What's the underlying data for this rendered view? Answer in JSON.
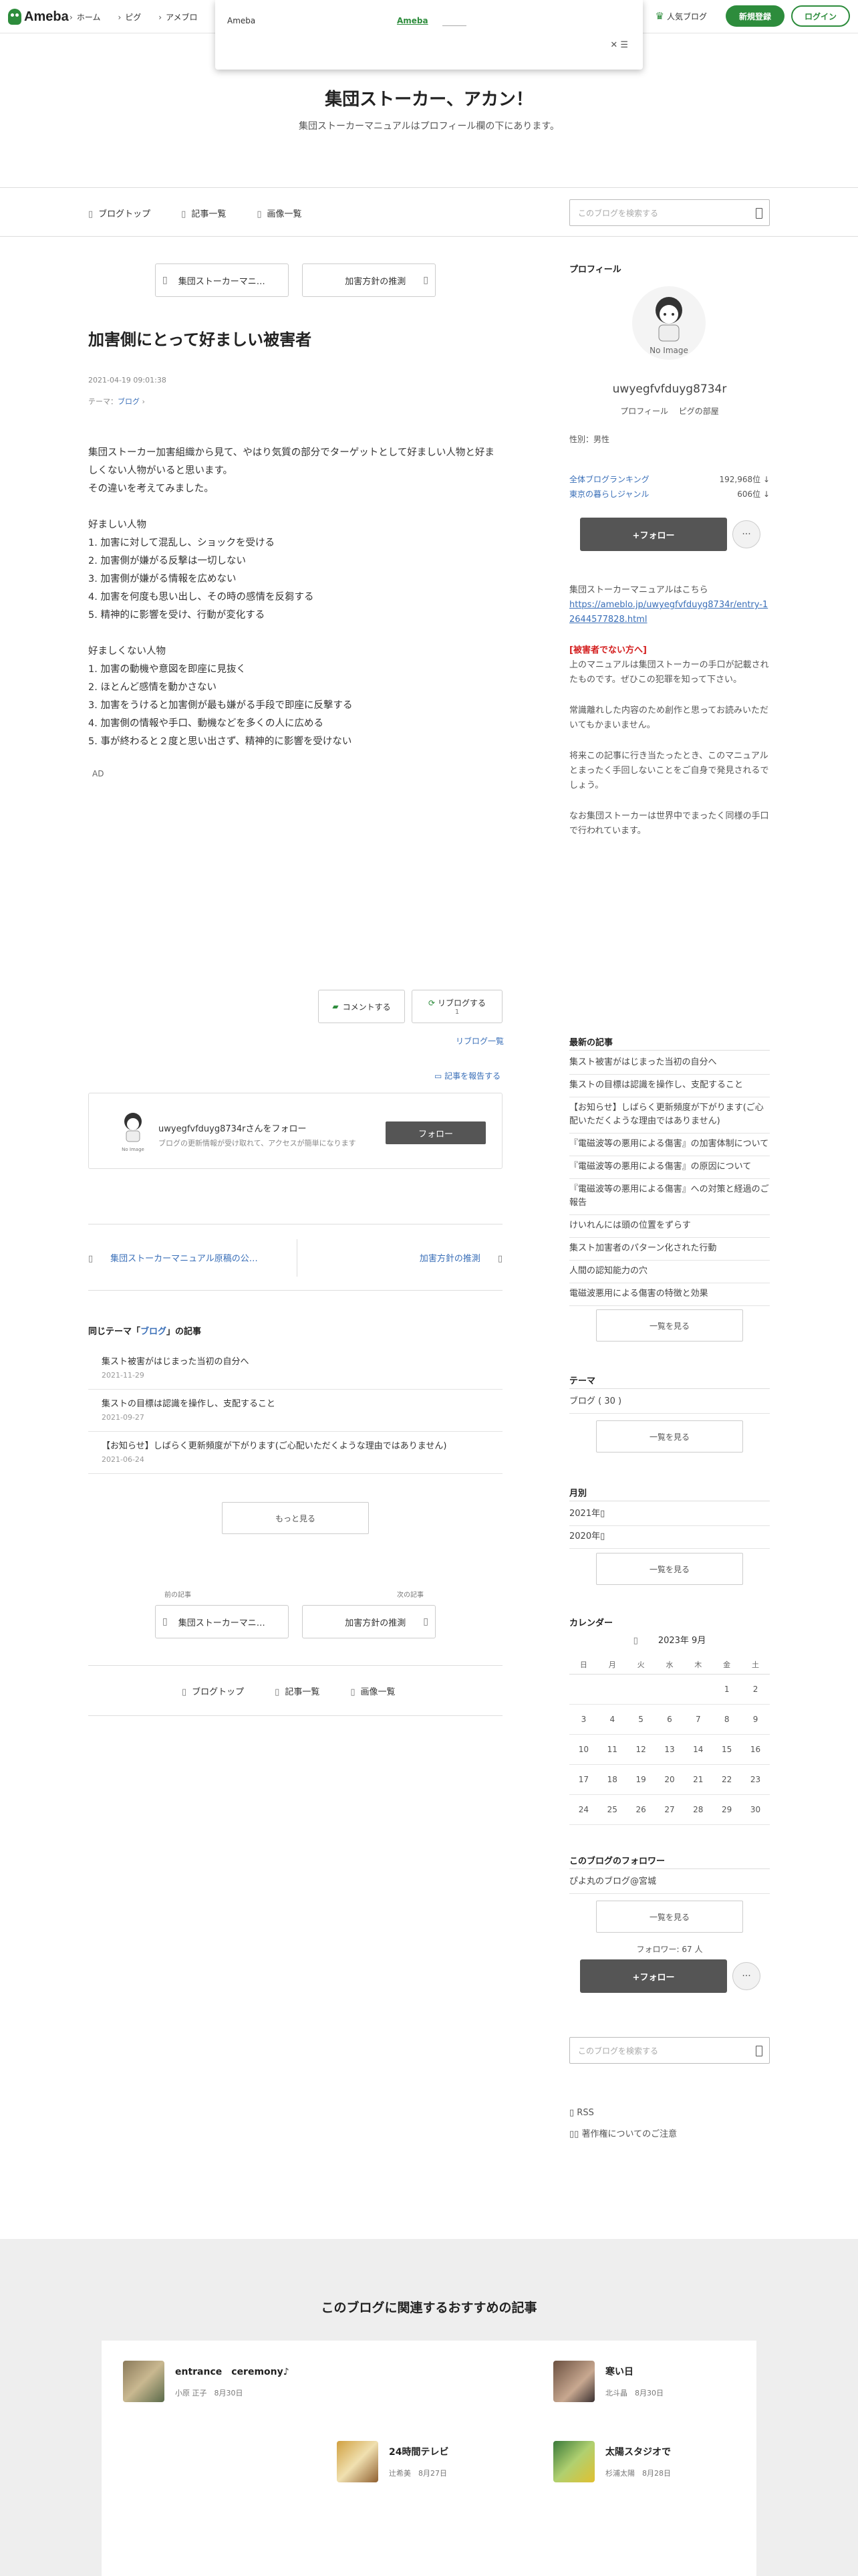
{
  "header": {
    "logo_text": "Ameba",
    "nav": [
      "ホーム",
      "ピグ",
      "アメブロ"
    ],
    "popular": "人気ブログ",
    "signup": "新規登録",
    "login": "ログイン"
  },
  "popup": {
    "title": "Ameba",
    "link": "Ameba",
    "close": "✕ ☰"
  },
  "blog": {
    "title": "集団ストーカー、アカン！",
    "description": "集団ストーカーマニュアルはプロフィール欄の下にあります。"
  },
  "blognav": {
    "items": [
      "ブログトップ",
      "記事一覧",
      "画像一覧"
    ],
    "search_placeholder": "このブログを検索する"
  },
  "article": {
    "prev_label": "集団ストーカーマニ…",
    "next_label": "加害方針の推測",
    "title": "加害側にとって好ましい被害者",
    "date": "2021-04-19 09:01:38",
    "theme_prefix": "テーマ：",
    "theme": "ブログ",
    "body": "集団ストーカー加害組織から見て、やはり気質の部分でターゲットとして好ましい人物と好ましくない人物がいると思います。\nその違いを考えてみました。\n\n好ましい人物\n1. 加害に対して混乱し、ショックを受ける\n2. 加害側が嫌がる反撃は一切しない\n3. 加害側が嫌がる情報を広めない\n4. 加害を何度も思い出し、その時の感情を反芻する\n5. 精神的に影響を受け、行動が変化する\n\n好ましくない人物\n1. 加害の動機や意図を即座に見抜く\n2. ほとんど感情を動かさない\n3. 加害をうけると加害側が最も嫌がる手段で即座に反撃する\n4. 加害側の情報や手口、動機などを多くの人に広める\n5. 事が終わると２度と思い出さず、精神的に影響を受けない",
    "ad_label": "AD",
    "comment_btn": "コメントする",
    "reblog_btn": "リブログする",
    "reblog_count": "1",
    "reblog_list": "リブログ一覧",
    "report": "記事を報告する"
  },
  "follow_card": {
    "title": "uwyegfvfduyg8734rさんをフォロー",
    "sub": "ブログの更新情報が受け取れて、アクセスが簡単になります",
    "button": "フォロー",
    "no_image": "No Image"
  },
  "prevnext": {
    "prev": "集団ストーカーマニュアル原稿の公…",
    "next": "加害方針の推測"
  },
  "same_theme": {
    "heading_pre": "同じテーマ「",
    "heading_theme": "ブログ",
    "heading_post": "」の記事",
    "items": [
      {
        "title": "集スト被害がはじまった当初の自分へ",
        "date": "2021-11-29"
      },
      {
        "title": "集ストの目標は認識を操作し、支配すること",
        "date": "2021-09-27"
      },
      {
        "title": "【お知らせ】しばらく更新頻度が下がります(ご心配いただくような理由ではありません)",
        "date": "2021-06-24"
      }
    ],
    "more": "もっと見る"
  },
  "bottom_pager": {
    "prev_caption": "前の記事",
    "next_caption": "次の記事",
    "prev": "集団ストーカーマニ…",
    "next": "加害方針の推測"
  },
  "bottomnav": {
    "items": [
      "ブログトップ",
      "記事一覧",
      "画像一覧"
    ]
  },
  "sidebar": {
    "profile_heading": "プロフィール",
    "no_image": "No Image",
    "name": "uwyegfvfduyg8734r",
    "sub": "プロフィール　 ピグの部屋",
    "gender": "性別：男性",
    "ranking": [
      {
        "label": "全体ブログランキング",
        "value": "192,968位"
      },
      {
        "label": "東京の暮らしジャンル",
        "value": "606位"
      }
    ],
    "follow_btn": "+フォロー",
    "more": "···",
    "text_intro": "集団ストーカーマニュアルはこちら",
    "text_url": "https://ameblo.jp/uwyegfvfduyg8734r/entry-12644577828.html",
    "text_red": "[被害者でない方へ]",
    "text_p1": "上のマニュアルは集団ストーカーの手口が記載されたものです。ぜひこの犯罪を知って下さい。",
    "text_p2": "常識離れした内容のため創作と思ってお読みいただいてもかまいません。",
    "text_p3": "将来この記事に行き当たったとき、このマニュアルとまったく手回しないことをご自身で発見されるでしょう。",
    "text_p4": "なお集団ストーカーは世界中でまったく同様の手口で行われています。",
    "latest_heading": "最新の記事",
    "latest": [
      "集スト被害がはじまった当初の自分へ",
      "集ストの目標は認識を操作し、支配すること",
      "【お知らせ】しばらく更新頻度が下がります(ご心配いただくような理由ではありません)",
      "『電磁波等の悪用による傷害』の加害体制について",
      "『電磁波等の悪用による傷害』の原因について",
      "『電磁波等の悪用による傷害』への対策と経過のご報告",
      "けいれんには頭の位置をずらす",
      "集スト加害者のパターン化された行動",
      "人間の認知能力の穴",
      "電磁波悪用による傷害の特徴と効果"
    ],
    "see_all": "一覧を見る",
    "theme_heading": "テーマ",
    "themes": [
      "ブログ ( 30 )"
    ],
    "monthly_heading": "月別",
    "months": [
      "2021年",
      "2020年"
    ],
    "calendar_heading": "カレンダー",
    "calendar_month": "2023年 9月",
    "weekdays": [
      "日",
      "月",
      "火",
      "水",
      "木",
      "金",
      "土"
    ],
    "followers_heading": "このブログのフォロワー",
    "follower_name": "ぴよ丸のブログ@宮城",
    "follower_count": "フォロワー: 67 人",
    "search_placeholder": "このブログを検索する",
    "rss": "RSS",
    "copyright": "著作権についてのご注意"
  },
  "recommended": {
    "heading": "このブログに関連するおすすめの記事",
    "items": [
      {
        "title": "entrance　ceremony♪",
        "meta": "小原 正子　8月30日"
      },
      {
        "title": "寒い日",
        "meta": "北斗晶　8月30日"
      },
      {
        "title": "24時間テレビ",
        "meta": "辻希美　8月27日"
      },
      {
        "title": "太陽スタジオで",
        "meta": "杉浦太陽　8月28日"
      }
    ]
  },
  "colors": {
    "brand": "#2d8c3c",
    "link": "#3a6fb8",
    "red": "#d42020"
  }
}
